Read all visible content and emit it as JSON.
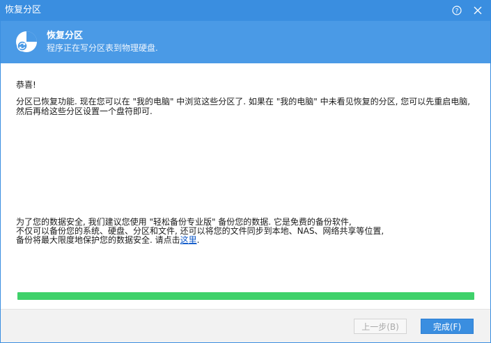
{
  "window": {
    "title": "恢复分区",
    "help_icon": "help-circle-icon",
    "close_icon": "close-icon"
  },
  "banner": {
    "icon": "partition-recovery-icon",
    "title": "恢复分区",
    "subtitle": "程序正在写分区表到物理硬盘."
  },
  "content": {
    "congrats": "恭喜!",
    "para1": "分区已恢复功能. 现在您可以在 \"我的电脑\" 中浏览这些分区了. 如果在 \"我的电脑\" 中未看见恢复的分区, 您可以先重启电脑, 然后再给这些分区设置一个盘符即可.",
    "para2_line1": "为了您的数据安全, 我们建议您使用 \"轻松备份专业版\" 备份您的数据. 它是免费的备份软件,",
    "para2_line2": "不仅可以备份您的系统、硬盘、分区和文件, 还可以将您的文件同步到本地、NAS、网络共享等位置,",
    "para2_line3_prefix": "备份将最大限度地保护您的数据安全. 请点击",
    "para2_link": "这里",
    "para2_line3_suffix": "."
  },
  "progress": {
    "value_percent": 100,
    "color": "#3fd16a"
  },
  "footer": {
    "prev_label": "上一步(B)",
    "finish_label": "完成(F)"
  },
  "colors": {
    "titlebar": "#3a8ee0",
    "banner": "#4a9ae6",
    "accent_button": "#3a8ee0"
  }
}
